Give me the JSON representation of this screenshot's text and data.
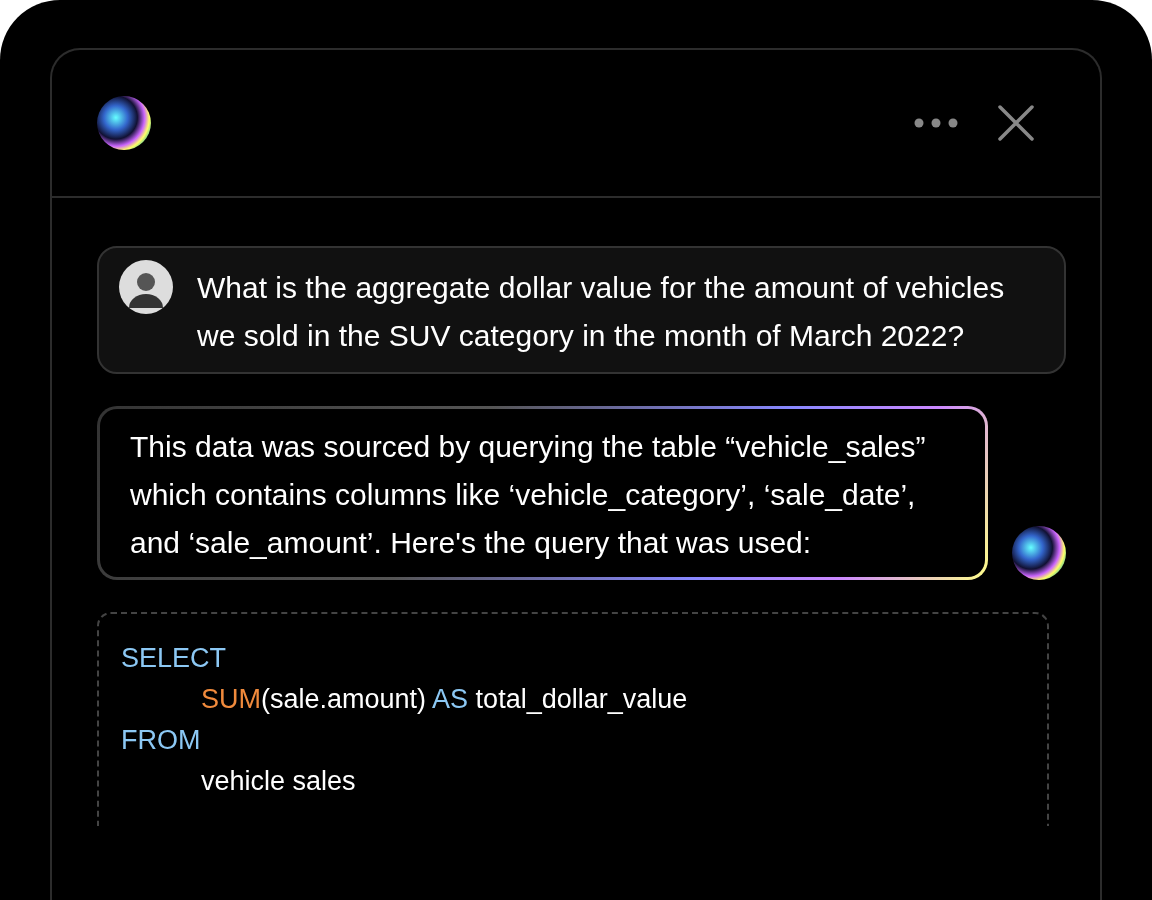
{
  "messages": [
    {
      "kind": "user",
      "text": "What is the aggregate dollar value for the amount of vehicles we sold in the SUV category in the month of March 2022?"
    },
    {
      "kind": "assistant",
      "text": "This data was sourced by querying the table “vehicle_sales” which contains columns like ‘vehicle_category’, ‘sale_date’, and ‘sale_amount’. Here's the query that was used:"
    }
  ],
  "code": [
    {
      "indented": false,
      "tokens": [
        {
          "kind": "keyword",
          "text": "SELECT"
        }
      ]
    },
    {
      "indented": true,
      "tokens": [
        {
          "kind": "function",
          "text": "SUM"
        },
        {
          "kind": "plain",
          "text": "(sale.amount)"
        },
        {
          "kind": "keyword",
          "text": " AS"
        },
        {
          "kind": "plain",
          "text": " total_dollar_value"
        }
      ]
    },
    {
      "indented": false,
      "tokens": [
        {
          "kind": "keyword",
          "text": "FROM"
        }
      ]
    },
    {
      "indented": true,
      "tokens": [
        {
          "kind": "plain",
          "text": "vehicle sales"
        }
      ]
    }
  ]
}
